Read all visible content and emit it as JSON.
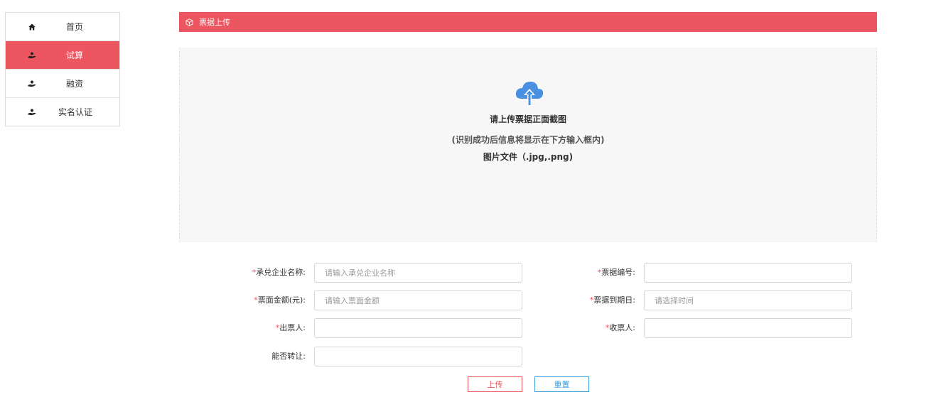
{
  "sidebar": {
    "items": [
      {
        "label": "首页",
        "icon": "home-icon",
        "active": false
      },
      {
        "label": "试算",
        "icon": "hand-coin-icon",
        "active": true
      },
      {
        "label": "融资",
        "icon": "hand-coin-icon",
        "active": false
      },
      {
        "label": "实名认证",
        "icon": "hand-coin-icon",
        "active": false
      }
    ]
  },
  "panel": {
    "title": "票据上传",
    "icon": "cube-icon"
  },
  "upload": {
    "icon": "cloud-upload-icon",
    "title": "请上传票据正面截图",
    "hint": "(识别成功后信息将显示在下方输入框内)",
    "types": "图片文件（.jpg,.png)"
  },
  "form": {
    "fields": [
      {
        "label": "承兑企业名称:",
        "required": true,
        "placeholder": "请输入承兑企业名称",
        "value": ""
      },
      {
        "label": "票据编号:",
        "required": true,
        "placeholder": "",
        "value": ""
      },
      {
        "label": "票面金额(元):",
        "required": true,
        "placeholder": "请输入票面金额",
        "value": ""
      },
      {
        "label": "票据到期日:",
        "required": true,
        "placeholder": "请选择时间",
        "value": ""
      },
      {
        "label": "出票人:",
        "required": true,
        "placeholder": "",
        "value": ""
      },
      {
        "label": "收票人:",
        "required": true,
        "placeholder": "",
        "value": ""
      },
      {
        "label": "能否转让:",
        "required": false,
        "placeholder": "",
        "value": ""
      }
    ],
    "required_mark": "*"
  },
  "buttons": {
    "upload": "上传",
    "reset": "重置"
  },
  "colors": {
    "accent": "#ec5660",
    "reset_blue": "#3a9ddb",
    "upload_icon_blue": "#4a90e2"
  }
}
